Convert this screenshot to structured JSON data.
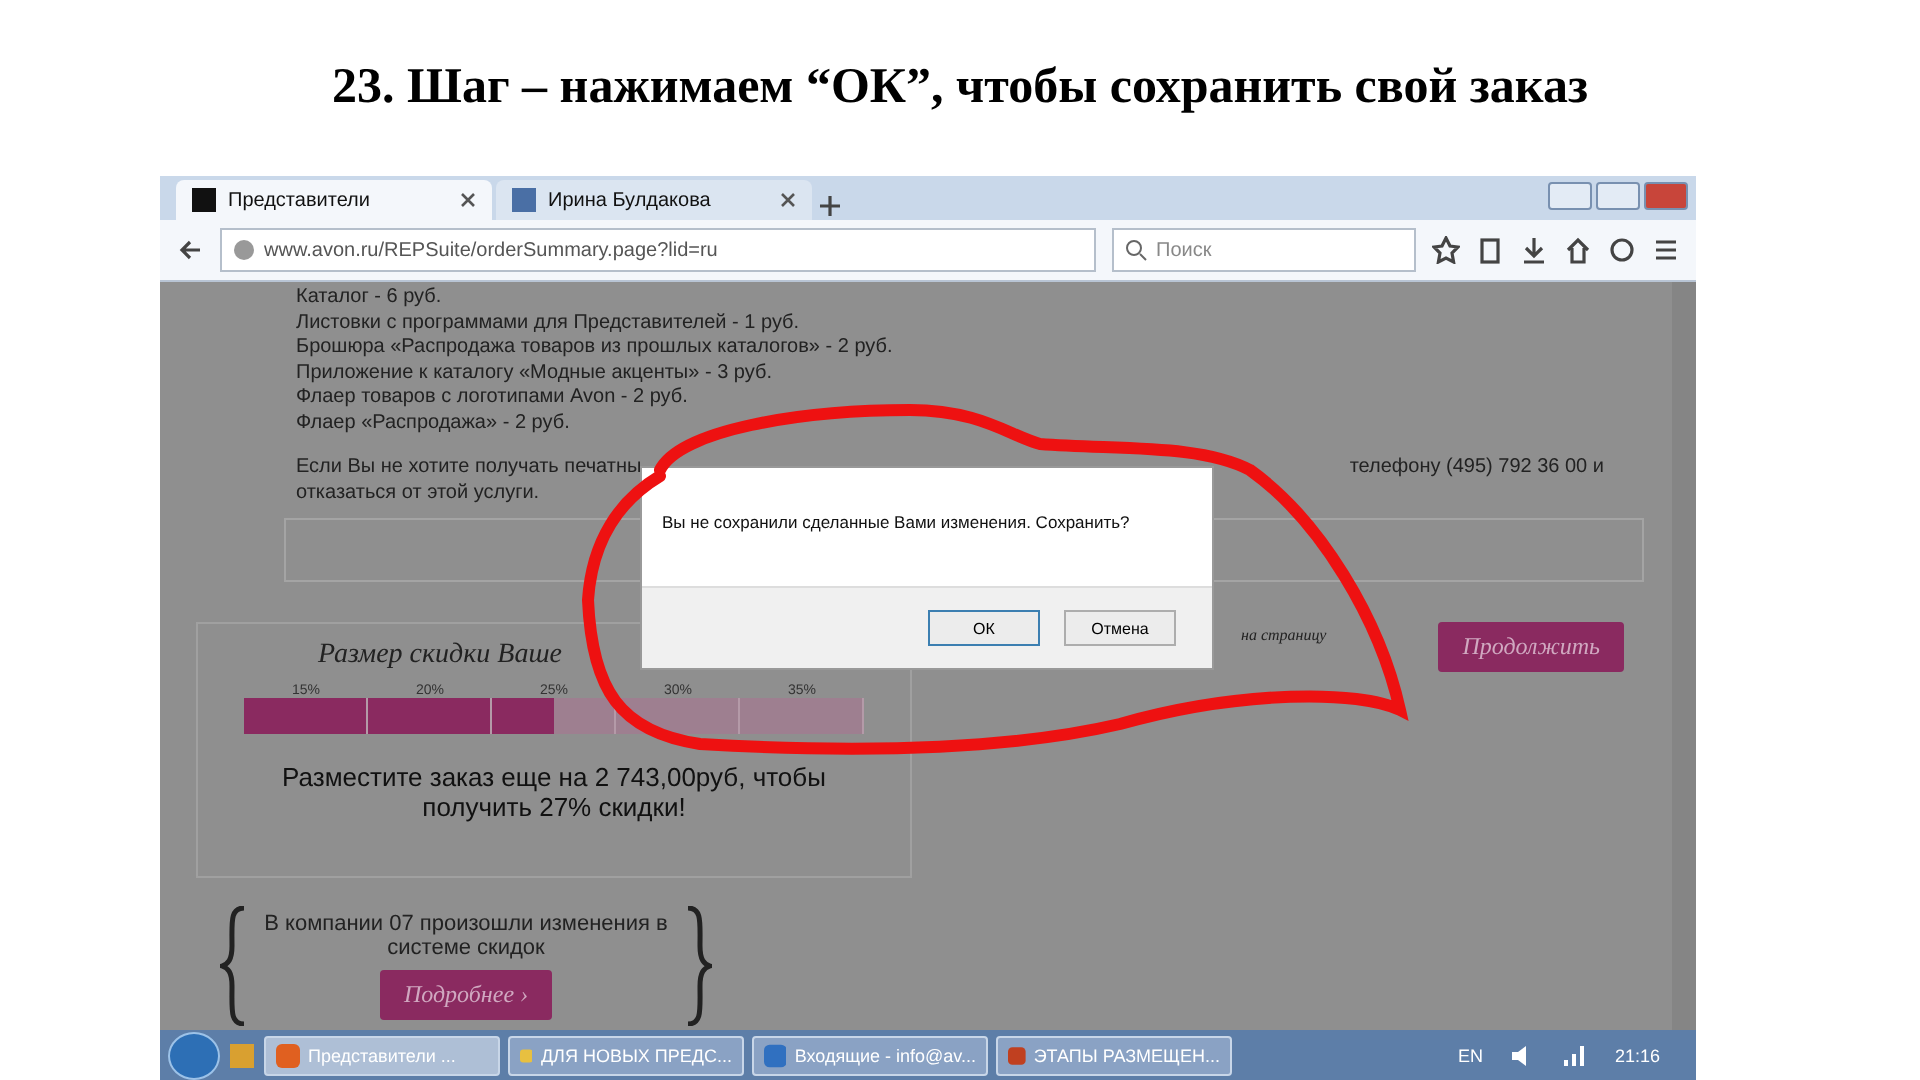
{
  "slide_title": "23. Шаг – нажимаем “ОК”, чтобы сохранить свой заказ",
  "browser": {
    "tabs": [
      {
        "label": "Представители",
        "selected": true
      },
      {
        "label": "Ирина Булдакова",
        "selected": false
      }
    ],
    "address": "www.avon.ru/REPSuite/orderSummary.page?lid=ru",
    "search_placeholder": "Поиск"
  },
  "materials": [
    "Каталог - 6 руб.",
    "Листовки с программами для Представителей - 1 руб.",
    "Брошюра «Распродажа товаров из прошлых каталогов» - 2 руб.",
    "Приложение к каталогу «Модные акценты» - 3 руб.",
    "Флаер товаров с логотипами Avon - 2 руб.",
    "Флаер «Распродажа» - 2 руб."
  ],
  "notice": {
    "left": "Если Вы не хотите получать печатны",
    "right": "телефону (495) 792 36 00 и",
    "line_2": "отказаться от этой услуги."
  },
  "dialog": {
    "message": "Вы не сохранили сделанные Вами изменения. Сохранить?",
    "buttons": [
      {
        "label": "ОК",
        "selected": true
      },
      {
        "label": "Отмена",
        "selected": false
      }
    ]
  },
  "discount": {
    "title": "Размер скидки Ваше",
    "ticks": [
      "15%",
      "20%",
      "25%",
      "30%",
      "35%"
    ],
    "level": 0.5,
    "message": "Разместите заказ еще на 2 743,00руб, чтобы получить 27% скидки!"
  },
  "promo": {
    "link": "на страницу",
    "button": "Продолжить"
  },
  "news": {
    "text": "В компании 07 произошли изменения в системе скидок",
    "button": "Подробнее ›"
  },
  "taskbar": {
    "items": [
      {
        "label": "Представители ...",
        "selected": true
      },
      {
        "label": "ДЛЯ НОВЫХ ПРЕДС...",
        "selected": false
      },
      {
        "label": "Входящие - info@av...",
        "selected": false
      },
      {
        "label": "ЭТАПЫ РАЗМЕЩЕН...",
        "selected": false
      }
    ],
    "language": "EN",
    "time": "21:16"
  }
}
